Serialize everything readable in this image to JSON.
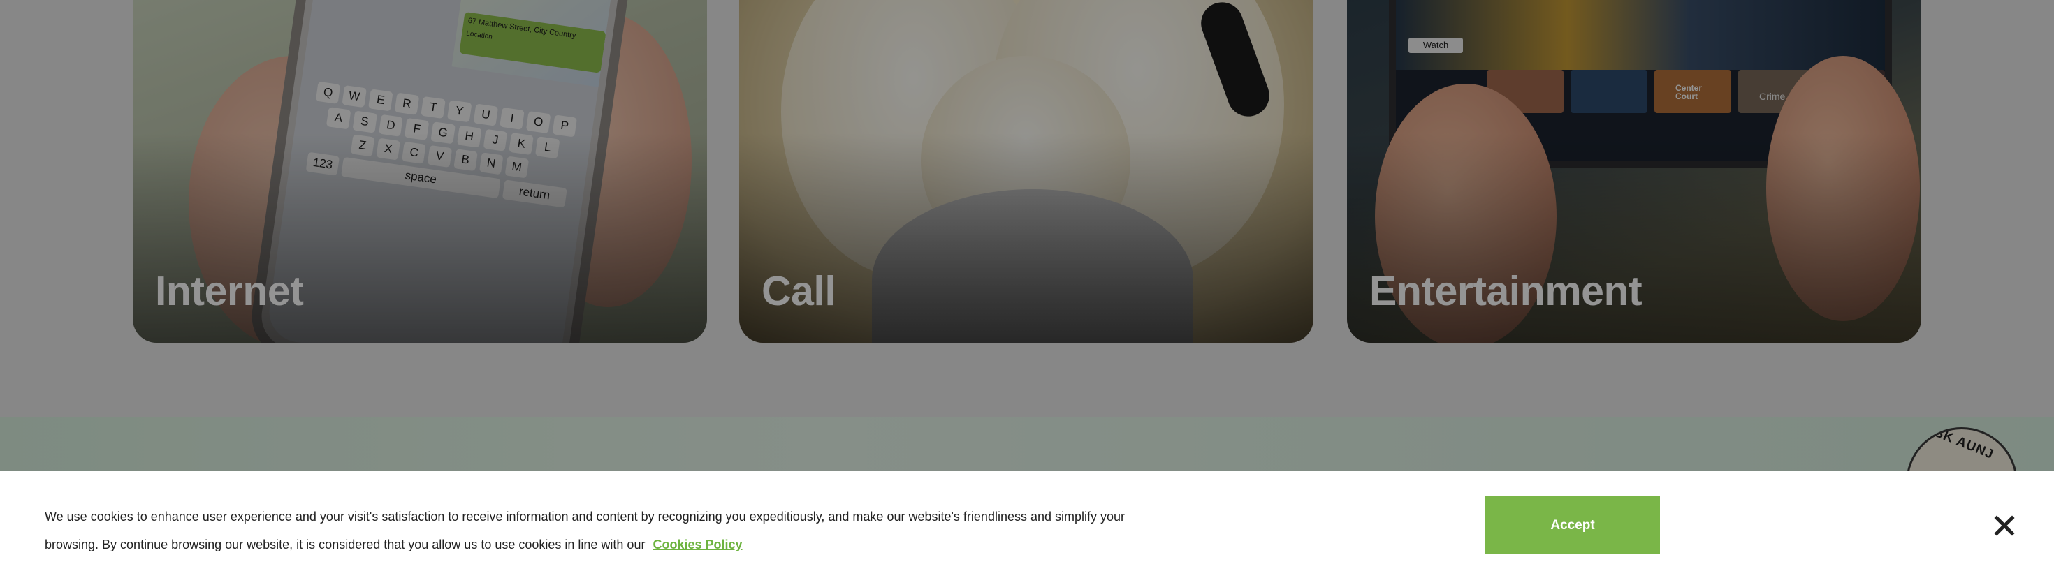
{
  "cards": [
    {
      "title": "Internet"
    },
    {
      "title": "Call"
    },
    {
      "title": "Entertainment"
    }
  ],
  "internet_artwork": {
    "map_address": "67 Matthew Street, City Country",
    "map_location": "Location",
    "keyboard_rows": [
      [
        "Q",
        "W",
        "E",
        "R",
        "T",
        "Y",
        "U",
        "I",
        "O",
        "P"
      ],
      [
        "A",
        "S",
        "D",
        "F",
        "G",
        "H",
        "J",
        "K",
        "L"
      ],
      [
        "Z",
        "X",
        "C",
        "V",
        "B",
        "N",
        "M"
      ]
    ],
    "keyboard_num": "123",
    "keyboard_space": "space",
    "keyboard_return": "return"
  },
  "entertainment_artwork": {
    "watch_label": "Watch",
    "thumb_labels": [
      "Center Court",
      "Crime"
    ]
  },
  "mascot": {
    "label": "ASK AUNJ"
  },
  "cookie_banner": {
    "message": "We use cookies to enhance user experience and your visit's satisfaction to receive information and content by recognizing you expeditiously, and make our website's friendliness and simplify your browsing. By continue browsing our website, it is considered that you allow us to use cookies in line with our",
    "policy_link": "Cookies Policy",
    "accept_label": "Accept",
    "close_icon": "close-icon",
    "accent_color": "#7ab648"
  }
}
